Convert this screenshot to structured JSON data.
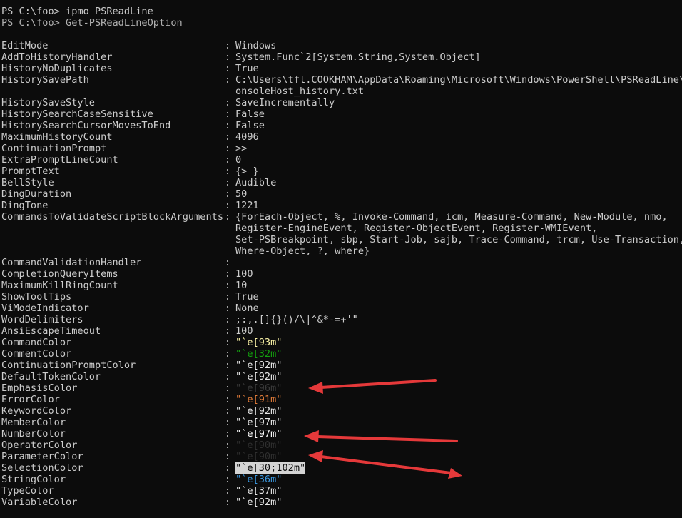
{
  "console": {
    "cmd1": "PS C:\\foo> ipmo PSReadLine",
    "cmd2": "PS C:\\foo> Get-PSReadLineOption",
    "sep": ":",
    "options": [
      {
        "name": "EditMode",
        "value": "Windows"
      },
      {
        "name": "AddToHistoryHandler",
        "value": "System.Func`2[System.String,System.Object]"
      },
      {
        "name": "HistoryNoDuplicates",
        "value": "True"
      },
      {
        "name": "HistorySavePath",
        "value": "C:\\Users\\tfl.COOKHAM\\AppData\\Roaming\\Microsoft\\Windows\\PowerShell\\PSReadLine\\C",
        "cont": [
          "onsoleHost_history.txt"
        ]
      },
      {
        "name": "HistorySaveStyle",
        "value": "SaveIncrementally"
      },
      {
        "name": "HistorySearchCaseSensitive",
        "value": "False"
      },
      {
        "name": "HistorySearchCursorMovesToEnd",
        "value": "False"
      },
      {
        "name": "MaximumHistoryCount",
        "value": "4096"
      },
      {
        "name": "ContinuationPrompt",
        "value": ">>"
      },
      {
        "name": "ExtraPromptLineCount",
        "value": "0"
      },
      {
        "name": "PromptText",
        "value": "{> }"
      },
      {
        "name": "BellStyle",
        "value": "Audible"
      },
      {
        "name": "DingDuration",
        "value": "50"
      },
      {
        "name": "DingTone",
        "value": "1221"
      },
      {
        "name": "CommandsToValidateScriptBlockArguments",
        "value": "{ForEach-Object, %, Invoke-Command, icm, Measure-Command, New-Module, nmo,",
        "cont": [
          "Register-EngineEvent, Register-ObjectEvent, Register-WMIEvent,",
          "Set-PSBreakpoint, sbp, Start-Job, sajb, Trace-Command, trcm, Use-Transaction,",
          "Where-Object, ?, where}"
        ]
      },
      {
        "name": "CommandValidationHandler",
        "value": ""
      },
      {
        "name": "CompletionQueryItems",
        "value": "100"
      },
      {
        "name": "MaximumKillRingCount",
        "value": "10"
      },
      {
        "name": "ShowToolTips",
        "value": "True"
      },
      {
        "name": "ViModeIndicator",
        "value": "None"
      },
      {
        "name": "WordDelimiters",
        "value": ";:,.[]{}()/\\|^&*-=+'\"–—―"
      },
      {
        "name": "AnsiEscapeTimeout",
        "value": "100"
      },
      {
        "name": "CommandColor",
        "value": "\"`e[93m\"",
        "color": "#f9f1a5"
      },
      {
        "name": "CommentColor",
        "value": "\"`e[32m\"",
        "color": "#13a10e"
      },
      {
        "name": "ContinuationPromptColor",
        "value": "\"`e[92m\"",
        "color": "#e8e8e8"
      },
      {
        "name": "DefaultTokenColor",
        "value": "\"`e[92m\"",
        "color": "#e8e8e8"
      },
      {
        "name": "EmphasisColor",
        "value": "\"`e[96m\"",
        "color": "#3a3a3a"
      },
      {
        "name": "ErrorColor",
        "value": "\"`e[91m\"",
        "color": "#e07b39"
      },
      {
        "name": "KeywordColor",
        "value": "\"`e[92m\"",
        "color": "#e8e8e8"
      },
      {
        "name": "MemberColor",
        "value": "\"`e[97m\"",
        "color": "#e8e8e8"
      },
      {
        "name": "NumberColor",
        "value": "\"`e[97m\"",
        "color": "#ffffff"
      },
      {
        "name": "OperatorColor",
        "value": "\"`e[90m\"",
        "color": "#2f2f2f"
      },
      {
        "name": "ParameterColor",
        "value": "\"`e[90m\"",
        "color": "#2f2f2f"
      },
      {
        "name": "SelectionColor",
        "value": "\"`e[30;102m\"",
        "selected": true
      },
      {
        "name": "StringColor",
        "value": "\"`e[36m\"",
        "color": "#3a96dd"
      },
      {
        "name": "TypeColor",
        "value": "\"`e[37m\"",
        "color": "#e8e8e8"
      },
      {
        "name": "VariableColor",
        "value": "\"`e[92m\"",
        "color": "#e8e8e8"
      }
    ]
  },
  "colors": {
    "background": "#0c0c0c",
    "foreground": "#cccccc",
    "arrow": "#e5393a"
  }
}
